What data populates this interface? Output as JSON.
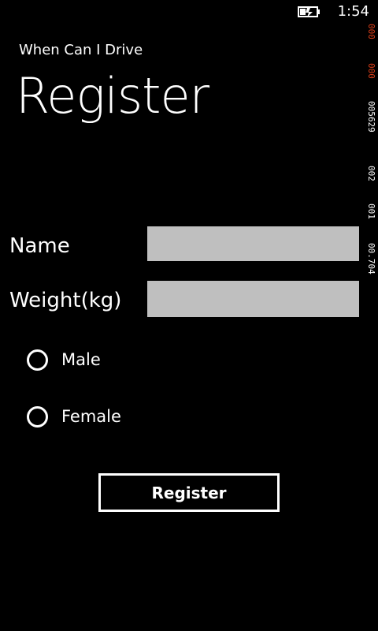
{
  "status_bar": {
    "time": "1:54",
    "battery_icon": "battery-charging-icon"
  },
  "frame_counter": {
    "segments": [
      "000",
      "000",
      "005629",
      "002",
      "001",
      "00.704"
    ],
    "highlight_color": "#e0401a"
  },
  "header": {
    "app_title": "When Can I Drive",
    "page_title": "Register"
  },
  "form": {
    "name_label": "Name",
    "name_value": "",
    "weight_label": "Weight(kg)",
    "weight_value": "",
    "gender_options": [
      {
        "label": "Male",
        "selected": false
      },
      {
        "label": "Female",
        "selected": false
      }
    ],
    "submit_label": "Register"
  },
  "colors": {
    "background": "#000000",
    "foreground": "#ffffff",
    "textbox": "#bfbfbf"
  }
}
